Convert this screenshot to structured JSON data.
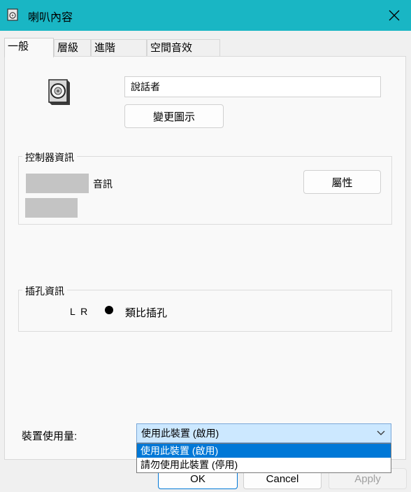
{
  "window": {
    "title": "喇叭內容",
    "icon": "speaker-icon",
    "close_icon": "close-icon",
    "accent": "#19b6c4"
  },
  "tabs": [
    {
      "label": "一般",
      "active": true
    },
    {
      "label": "層級",
      "active": false
    },
    {
      "label": "進階",
      "active": false
    },
    {
      "label": "空間音效",
      "active": false
    }
  ],
  "general": {
    "device_name": "說話者",
    "change_icon_label": "變更圖示",
    "controller": {
      "heading": "控制器資訊",
      "line1_suffix": "音訊",
      "properties_label": "屬性"
    },
    "jack": {
      "heading": "插孔資訊",
      "channels": "L R",
      "type": "類比插孔"
    },
    "usage": {
      "label": "裝置使用量:",
      "selected": "使用此裝置 (啟用)",
      "options": [
        "使用此裝置 (啟用)",
        "請勿使用此裝置 (停用)"
      ],
      "highlight": "#0078d7"
    }
  },
  "footer": {
    "ok_label": "OK",
    "cancel_label": "Cancel",
    "apply_label": "Apply"
  }
}
